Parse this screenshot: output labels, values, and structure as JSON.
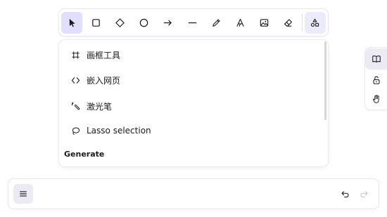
{
  "toolbar": {
    "tools": [
      {
        "name": "selection",
        "icon": "pointer-icon",
        "active": true
      },
      {
        "name": "rectangle",
        "icon": "rectangle-icon"
      },
      {
        "name": "diamond",
        "icon": "diamond-icon"
      },
      {
        "name": "ellipse",
        "icon": "ellipse-icon"
      },
      {
        "name": "arrow",
        "icon": "arrow-icon"
      },
      {
        "name": "line",
        "icon": "line-icon"
      },
      {
        "name": "draw",
        "icon": "pencil-icon"
      },
      {
        "name": "text",
        "icon": "text-icon"
      },
      {
        "name": "image",
        "icon": "image-icon"
      },
      {
        "name": "eraser",
        "icon": "eraser-icon"
      },
      {
        "name": "more-tools",
        "icon": "shapes-icon"
      }
    ],
    "active_color": "#e0dfff"
  },
  "menu": {
    "items": [
      {
        "label": "画框工具",
        "icon": "frame-icon"
      },
      {
        "label": "嵌入网页",
        "icon": "embed-icon"
      },
      {
        "label": "激光笔",
        "icon": "laser-icon"
      },
      {
        "label": "Lasso selection",
        "icon": "lasso-icon"
      }
    ],
    "section_heading": "Generate"
  },
  "side_panel": {
    "buttons": [
      {
        "icon": "book-icon"
      },
      {
        "icon": "unlock-icon"
      },
      {
        "icon": "hand-icon"
      }
    ]
  },
  "bottom_bar": {
    "menu_icon": "hamburger-icon",
    "undo_icon": "undo-icon",
    "redo_icon": "redo-icon"
  }
}
